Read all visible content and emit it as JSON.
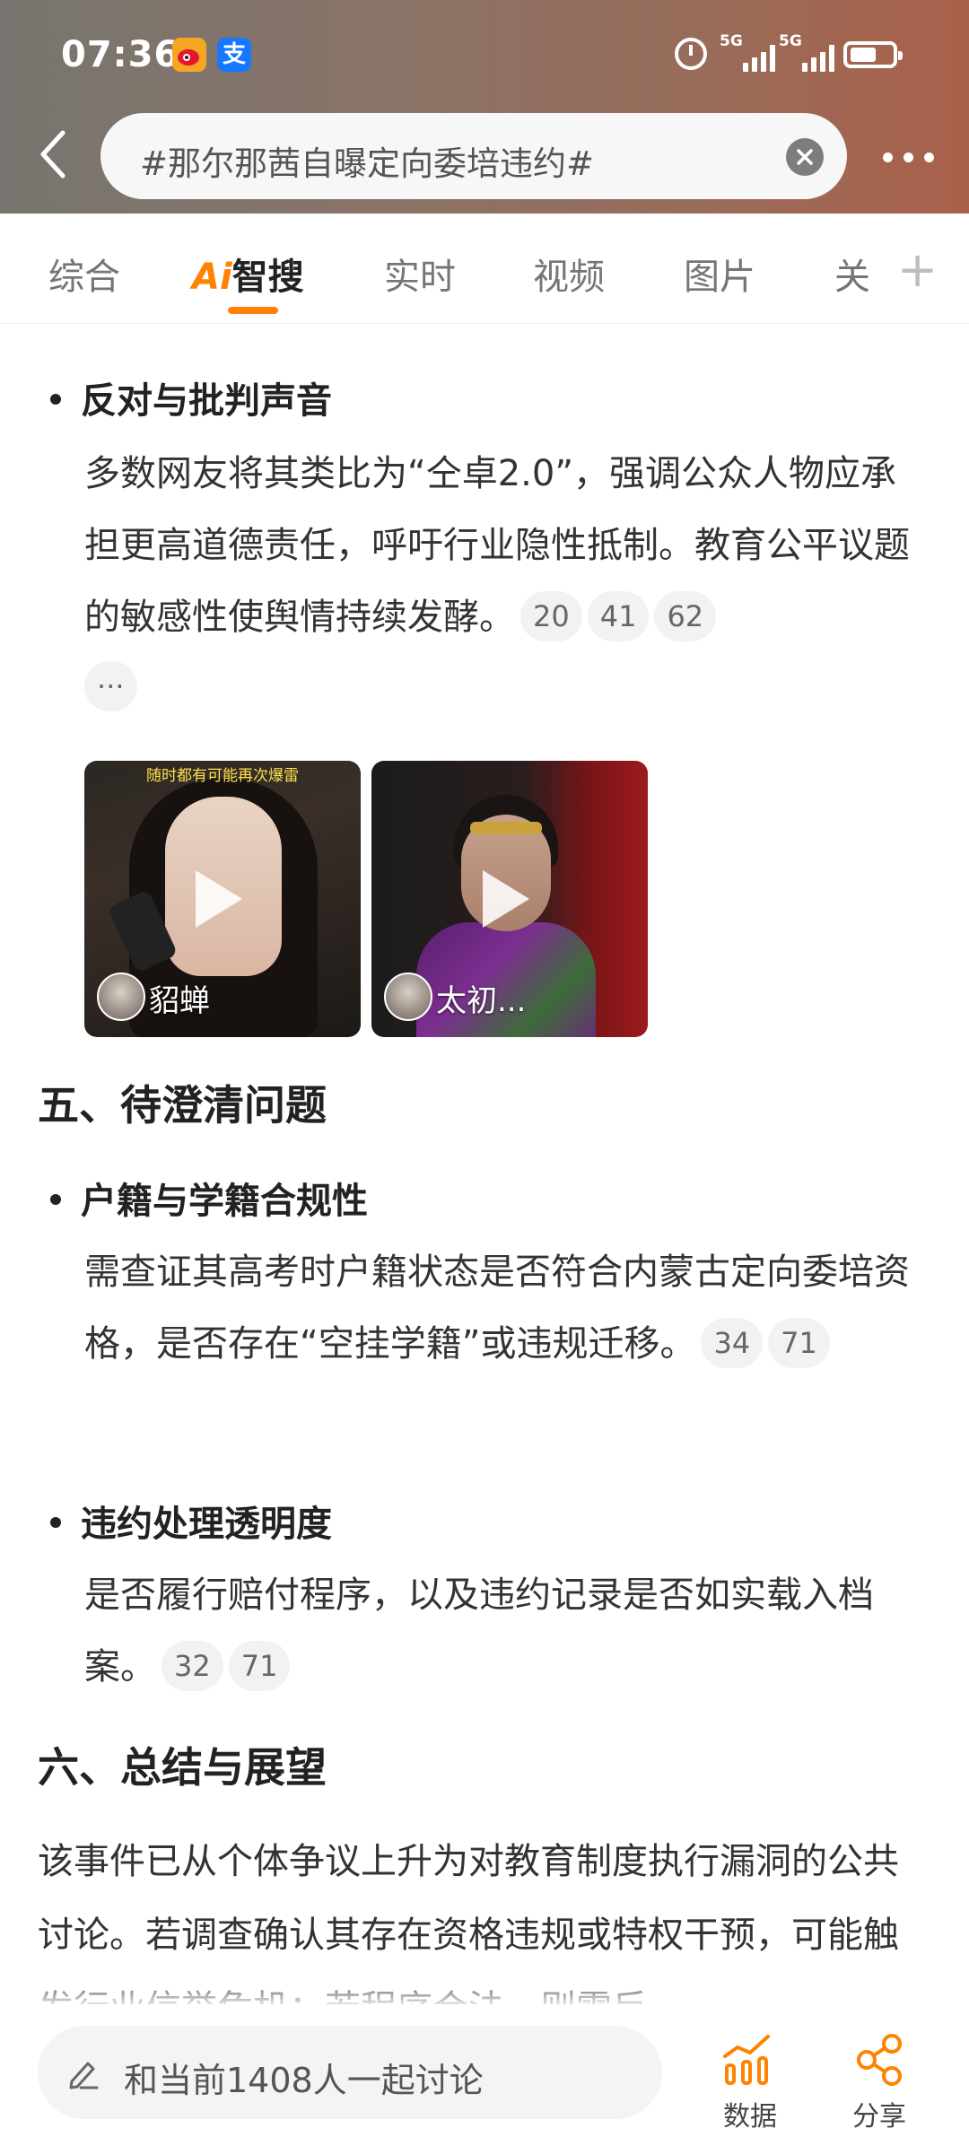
{
  "status_bar": {
    "time": "07:36",
    "apps": [
      "weibo-icon",
      "alipay-icon"
    ],
    "alipay_glyph": "支",
    "network": [
      "5G",
      "5G"
    ]
  },
  "search": {
    "query": "#那尔那茜自曝定向委培违约#"
  },
  "tabs": [
    {
      "label": "综合"
    },
    {
      "label": "智搜",
      "prefix": "Ai",
      "active": true
    },
    {
      "label": "实时"
    },
    {
      "label": "视频"
    },
    {
      "label": "图片"
    },
    {
      "label": "关"
    }
  ],
  "content": {
    "bullet1": {
      "title": "反对与批判声音",
      "text": "多数网友将其类比为“仝卓2.0”，强调公众人物应承担更高道德责任，呼吁行业隐性抵制。教育公平议题的敏感性使舆情持续发酵。",
      "refs": [
        "20",
        "41",
        "62"
      ],
      "more": "···"
    },
    "videos": [
      {
        "label": "貂蝉",
        "caption": "随时都有可能再次爆雷"
      },
      {
        "label": "太初..."
      }
    ],
    "section5": {
      "title": "五、待澄清问题",
      "bullet1": {
        "title": "户籍与学籍合规性",
        "text": "需查证其高考时户籍状态是否符合内蒙古定向委培资格，是否存在“空挂学籍”或违规迁移。",
        "refs": [
          "34",
          "71"
        ]
      },
      "bullet2": {
        "title": "违约处理透明度",
        "text": "是否履行赔付程序，以及违约记录是否如实载入档案。",
        "refs": [
          "32",
          "71"
        ]
      }
    },
    "section6": {
      "title": "六、总结与展望",
      "text": "该事件已从个体争议上升为对教育制度执行漏洞的公共讨论。若调查确认其存在资格违规或特权干预，可能触发行业信誉危机；若程序合法，则需反"
    }
  },
  "bottom_bar": {
    "discuss_placeholder": "和当前1408人一起讨论",
    "data_label": "数据",
    "share_label": "分享"
  },
  "colors": {
    "accent": "#ff8200",
    "header_gradient_start": "#77756f",
    "header_gradient_end": "#a9604a"
  }
}
